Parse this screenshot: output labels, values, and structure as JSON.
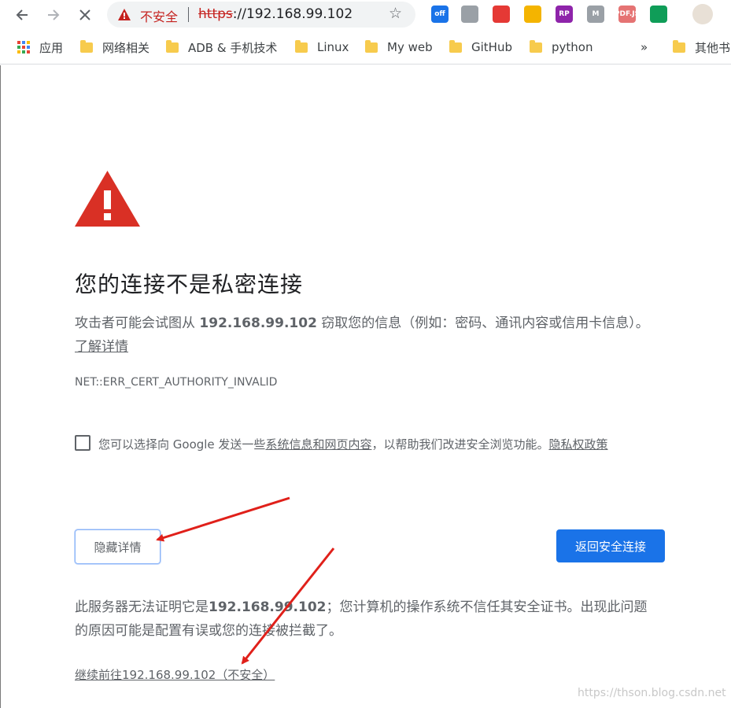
{
  "toolbar": {
    "security_label": "不安全",
    "url_scheme": "https",
    "url_rest": "://192.168.99.102",
    "extensions": [
      {
        "name": "off-extension",
        "label": "off",
        "color": "#1a73e8"
      },
      {
        "name": "compass-extension",
        "label": "",
        "color": "#9aa0a6"
      },
      {
        "name": "red-extension",
        "label": "",
        "color": "#e53935"
      },
      {
        "name": "flower-extension",
        "label": "",
        "color": "#f4b400"
      },
      {
        "name": "rp-extension",
        "label": "RP",
        "color": "#8e24aa"
      },
      {
        "name": "m-extension",
        "label": "M",
        "color": "#9aa0a6"
      },
      {
        "name": "pdfjs-extension",
        "label": "PDF.JS",
        "color": "#e57373"
      },
      {
        "name": "sync-extension",
        "label": "",
        "color": "#0f9d58"
      }
    ]
  },
  "bookmarks": {
    "apps_label": "应用",
    "items": [
      "网络相关",
      "ADB & 手机技术",
      "Linux",
      "My web",
      "GitHub",
      "python"
    ],
    "overflow": "»",
    "other": "其他书"
  },
  "page": {
    "heading": "您的连接不是私密连接",
    "desc_1": "攻击者可能会试图从 ",
    "desc_host": "192.168.99.102",
    "desc_2": " 窃取您的信息（例如：密码、通讯内容或信用卡信息）。",
    "learn_more": "了解详情",
    "error_code": "NET::ERR_CERT_AUTHORITY_INVALID",
    "optin_1": "您可以选择向 Google 发送一些",
    "optin_link": "系统信息和网页内容",
    "optin_2": "，以帮助我们改进安全浏览功能。",
    "privacy_link": "隐私权政策",
    "hide_details": "隐藏详情",
    "back_to_safety": "返回安全连接",
    "details_1": "此服务器无法证明它是",
    "details_host": "192.168.99.102",
    "details_2": "；您计算机的操作系统不信任其安全证书。出现此问题的原因可能是配置有误或您的连接被拦截了。",
    "proceed_link": "继续前往192.168.99.102（不安全）",
    "watermark": "https://thson.blog.csdn.net"
  },
  "colors": {
    "accent": "#1a73e8",
    "warning": "#d93025",
    "annotation": "#e0201a"
  }
}
